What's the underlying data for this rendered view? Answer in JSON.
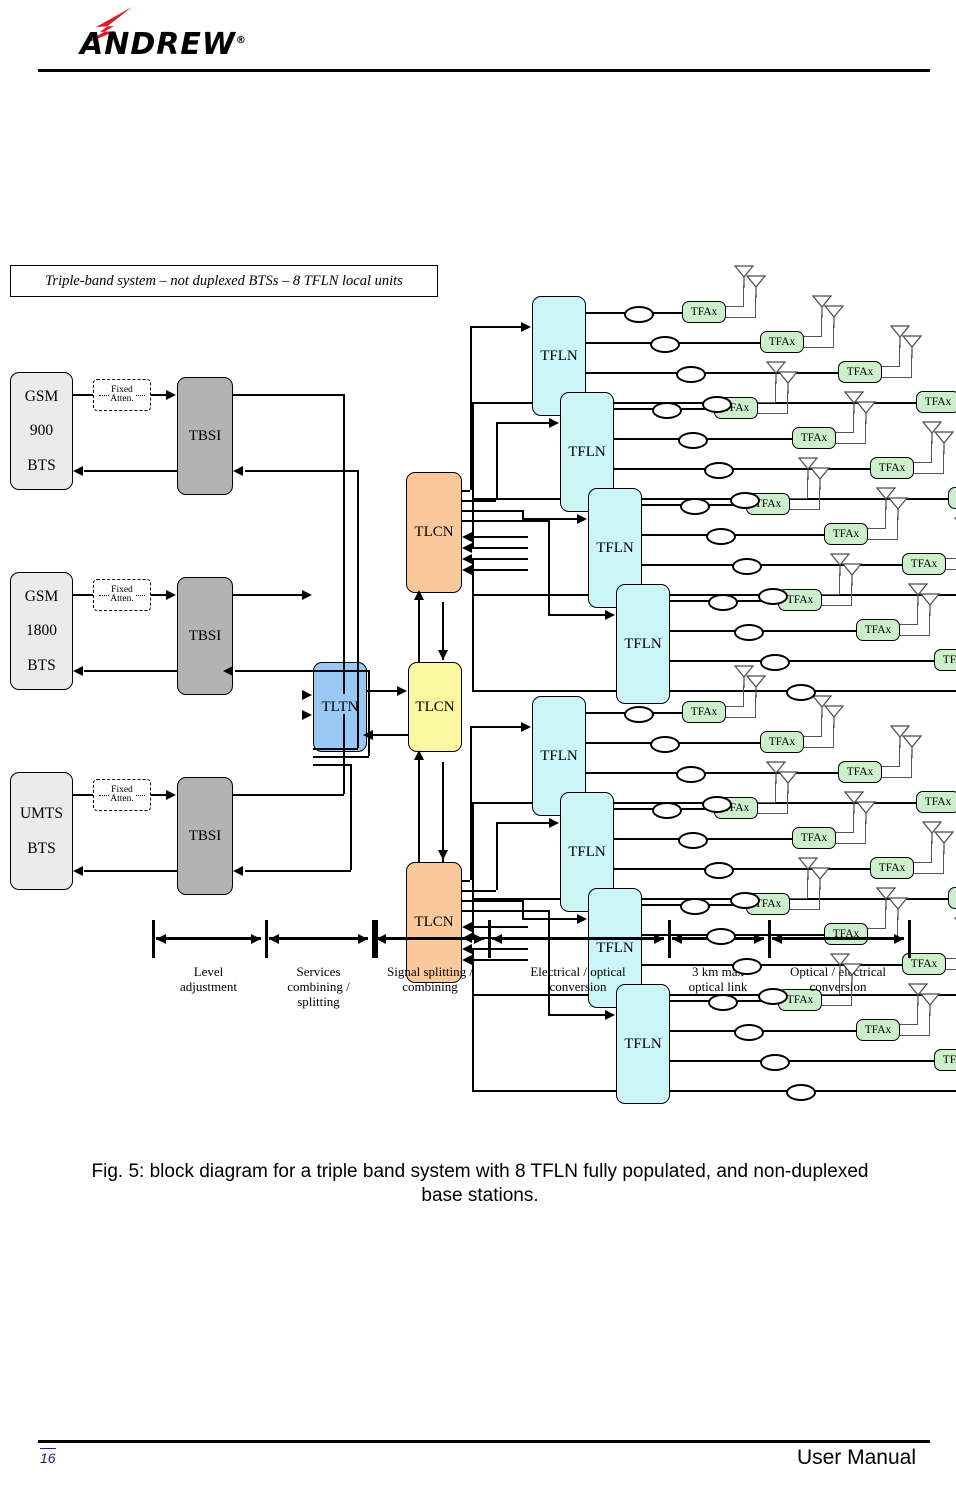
{
  "header": {
    "logo_text": "ANDREW",
    "logo_reg": "®",
    "logo_icon": "lightning-bolt-icon",
    "logo_color": "#E2182B"
  },
  "figure": {
    "title_box": "Triple-band system – not duplexed BTSs – 8 TFLN local units",
    "bts_nodes": [
      {
        "id": "bts-gsm900",
        "label": "GSM\n900\nBTS",
        "color": "#ebebeb"
      },
      {
        "id": "bts-gsm1800",
        "label": "GSM\n1800\nBTS",
        "color": "#ebebeb"
      },
      {
        "id": "bts-umts",
        "label": "UMTS\nBTS",
        "color": "#ebebeb"
      }
    ],
    "attenuator_label_line1": "Fixed",
    "attenuator_label_line2": "Atten.",
    "tbsi_label": "TBSI",
    "tbsi_color": "#b3b3b3",
    "tltn_label": "TLTN",
    "tltn_color": "#9ac8f4",
    "tlcn_label": "TLCN",
    "tlcn_color_outer": "#fac89a",
    "tlcn_color_center": "#fbf7a1",
    "tfln_label": "TFLN",
    "tfln_color": "#ccf5f7",
    "tfax_label": "TFAx",
    "tfax_color": "#ccf0cc",
    "tfln_count": 8,
    "tfax_per_tfln": 4,
    "antennas_per_tfax": 2
  },
  "scale": {
    "segments": [
      {
        "label": "Level\nadjustment"
      },
      {
        "label": "Services\ncombining /\nsplitting"
      },
      {
        "label": "Signal splitting /\ncombining"
      },
      {
        "label": "Electrical / optical\nconversion"
      },
      {
        "label": "3 km max\noptical link"
      },
      {
        "label": "Optical / electrical\nconversion"
      }
    ]
  },
  "caption": "Fig. 5: block diagram for a triple band system with 8 TFLN fully populated, and non-duplexed base stations.",
  "footer": {
    "page_number": "16",
    "manual_label": "User Manual"
  }
}
